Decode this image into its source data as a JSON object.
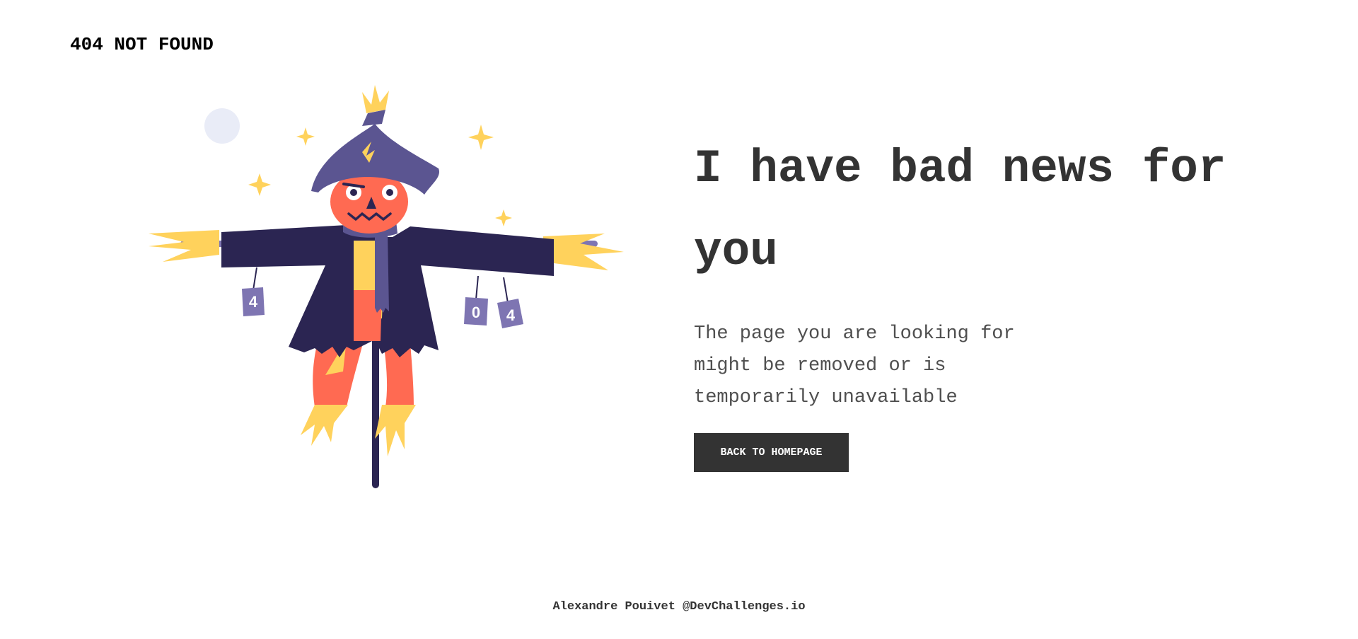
{
  "header": {
    "brand": "404 NOT FOUND"
  },
  "illustration": {
    "can_labels": [
      "4",
      "0",
      "4"
    ],
    "colors": {
      "coat": "#2b2552",
      "hat": "#5b5591",
      "face": "#ff6a52",
      "straw": "#ffd25c",
      "moon": "#e9ecf7",
      "can": "#7e75b2"
    }
  },
  "main": {
    "headline": "I have bad news for you",
    "description": "The page you are looking for might be removed or is temporarily unavailable",
    "button_label": "BACK TO HOMEPAGE"
  },
  "footer": {
    "credit": "Alexandre Pouivet @DevChallenges.io"
  },
  "colors": {
    "text": "#333333",
    "button_bg": "#333333",
    "button_text": "#ffffff",
    "background": "#ffffff"
  }
}
